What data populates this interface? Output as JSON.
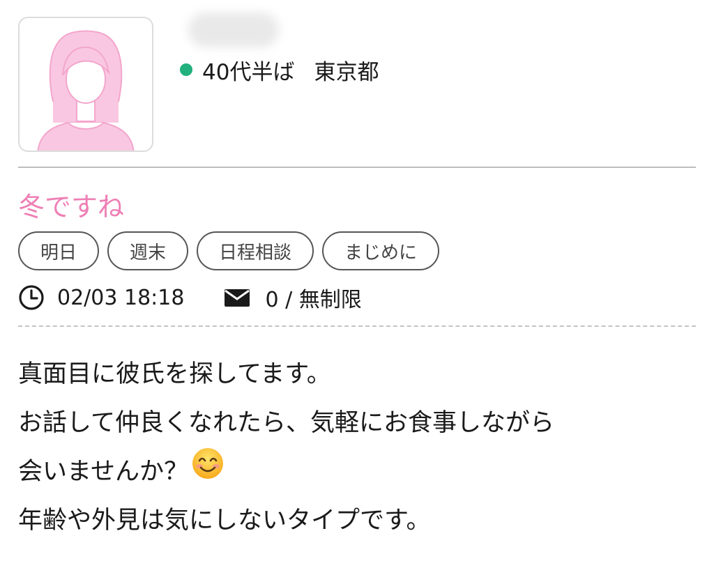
{
  "profile": {
    "age": "40代半ば",
    "location": "東京都",
    "online": true,
    "online_color": "#22b07d"
  },
  "post": {
    "title": "冬ですね",
    "title_color": "#ee7fb5",
    "tags": [
      "明日",
      "週末",
      "日程相談",
      "まじめに"
    ],
    "timestamp": "02/03 18:18",
    "messages": "0 / 無制限",
    "body_lines": [
      "真面目に彼氏を探してます。",
      "お話して仲良くなれたら、気軽にお食事しながら",
      "会いませんか？",
      "年齢や外見は気にしないタイプです。"
    ]
  },
  "icons": {
    "avatar": "female-silhouette-icon",
    "clock": "clock-icon",
    "mail": "envelope-icon",
    "emoji": "smiling-face-emoji"
  }
}
